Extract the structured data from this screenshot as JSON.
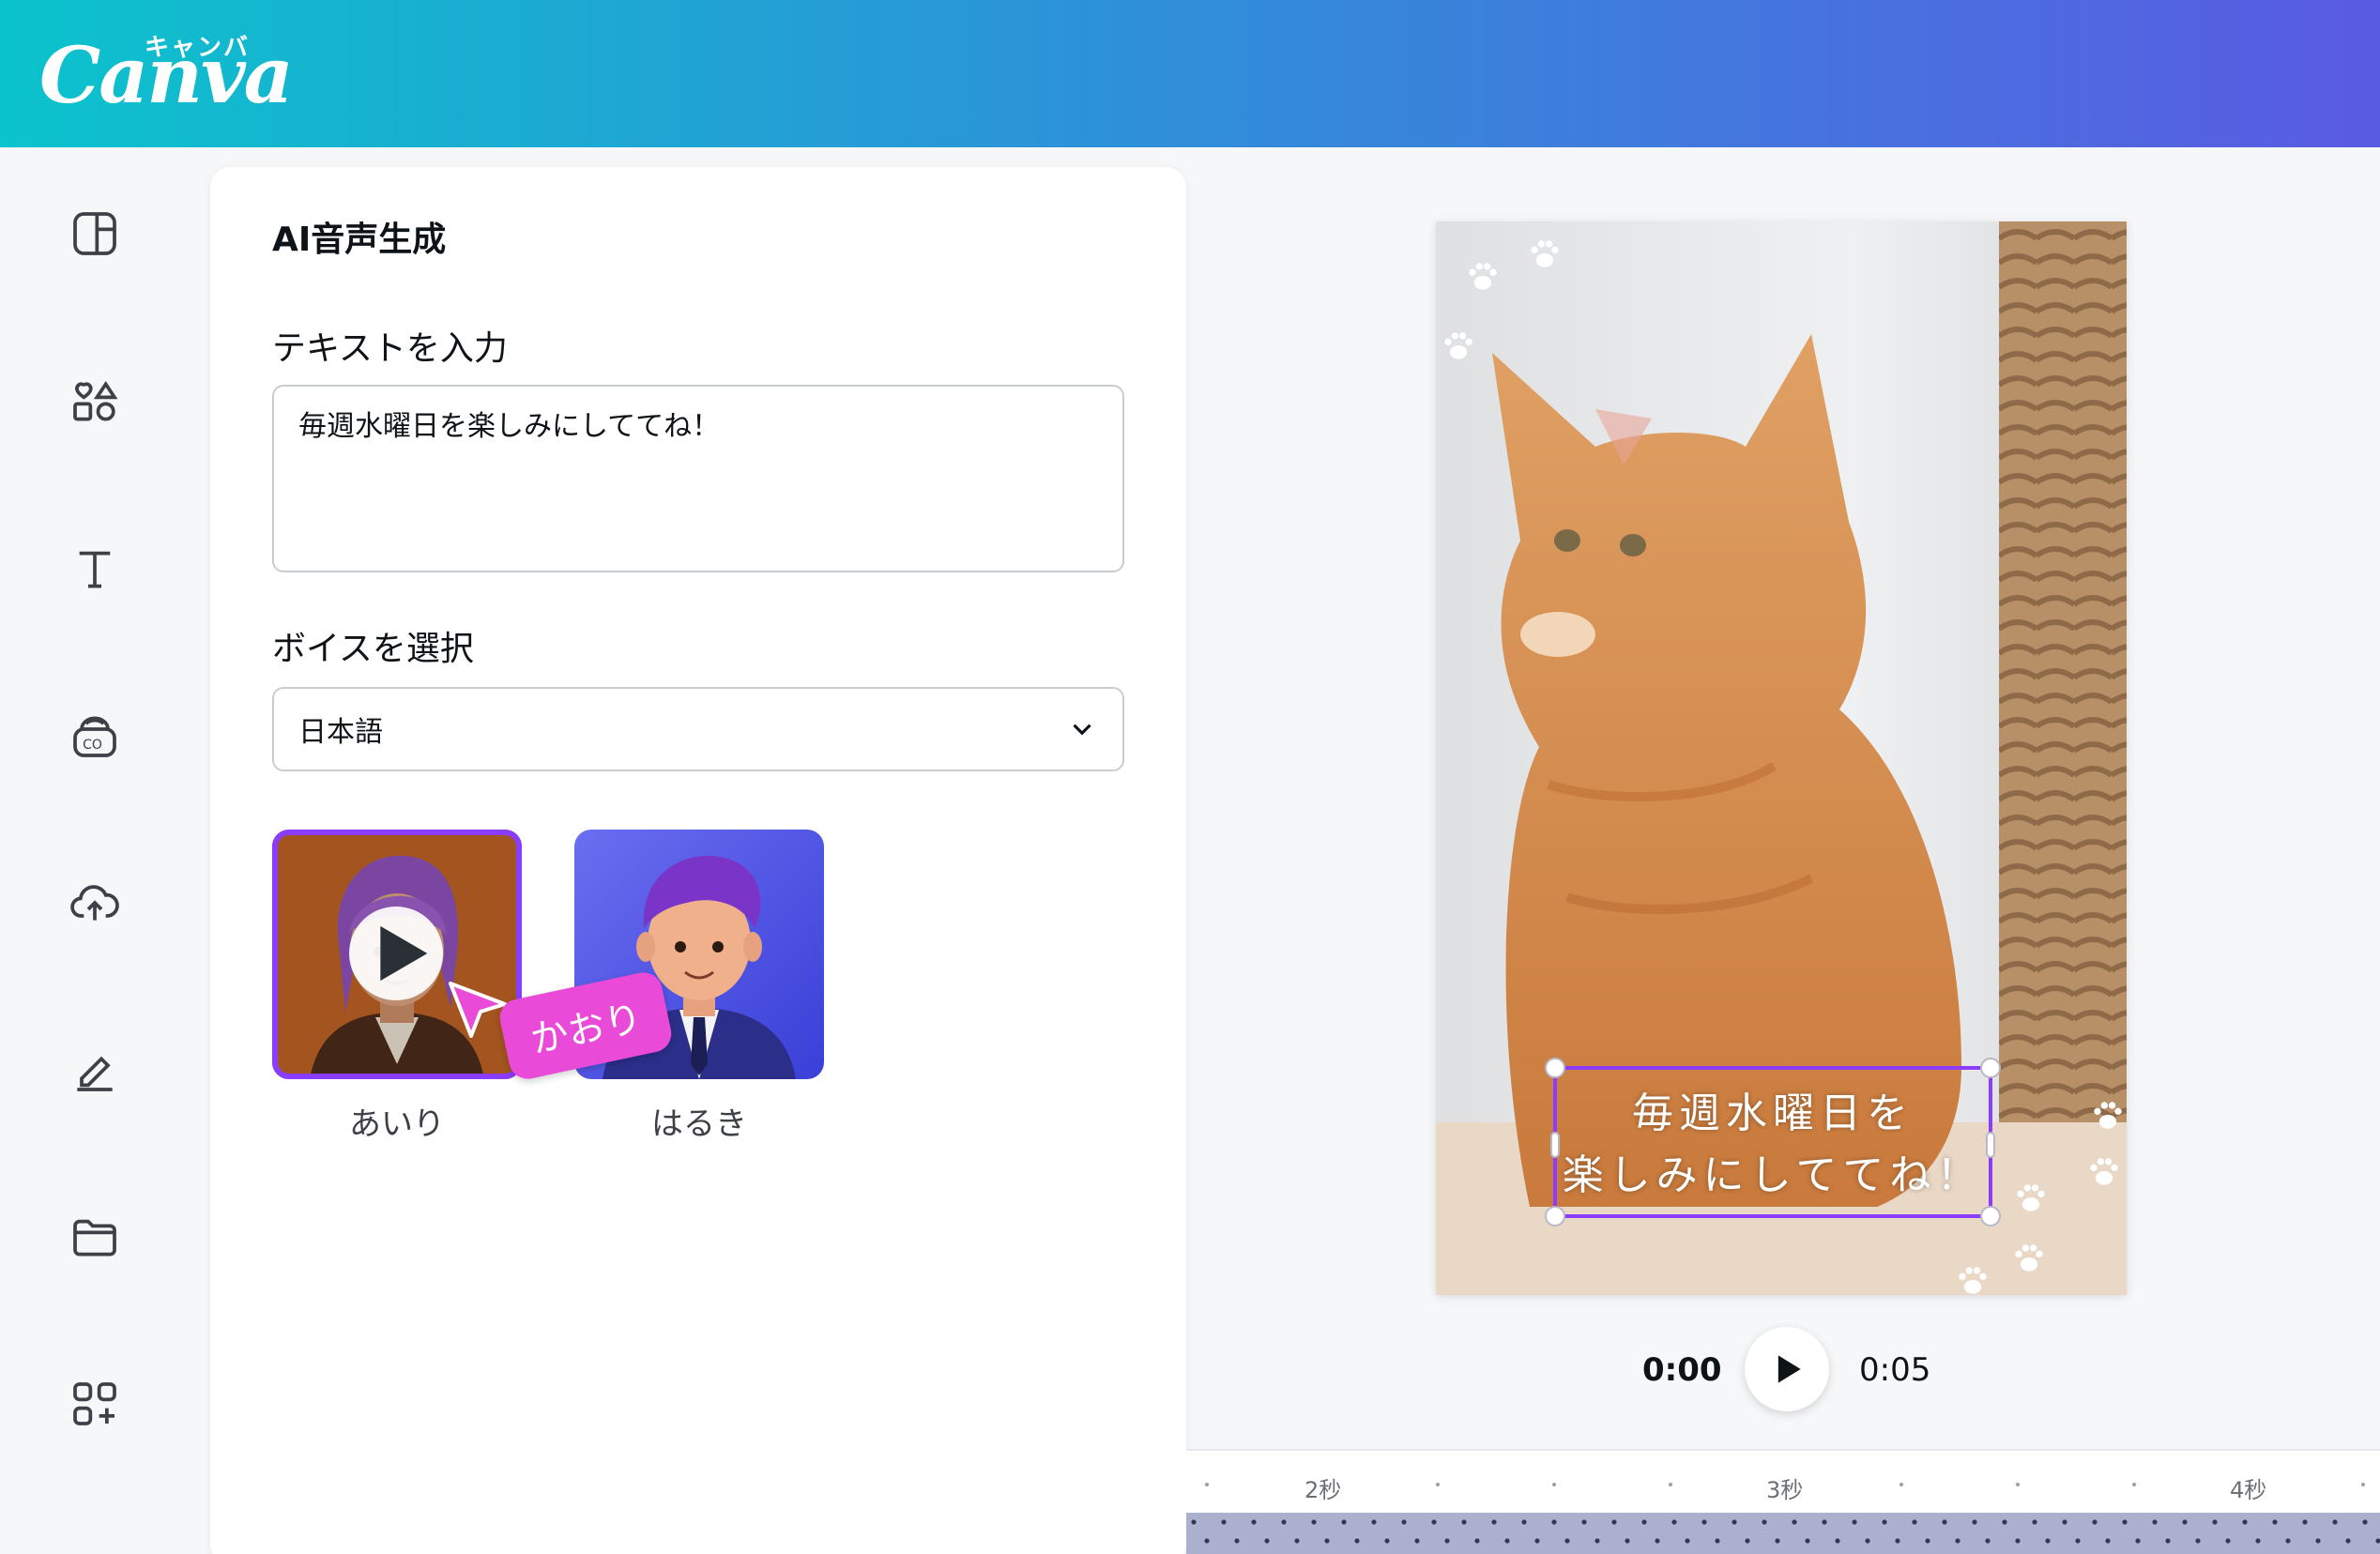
{
  "app": {
    "logo": "Canva",
    "logo_kana": "キャンバ"
  },
  "rail": [
    "layout-icon",
    "elements-icon",
    "text-icon",
    "brand-icon",
    "upload-icon",
    "draw-icon",
    "folder-icon",
    "apps-icon"
  ],
  "panel": {
    "title": "AI音声生成",
    "text_label": "テキストを入力",
    "text_value": "毎週水曜日を楽しみにしててね！",
    "voice_label": "ボイスを選択",
    "language": "日本語",
    "voices": [
      {
        "name": "あいり",
        "selected": true
      },
      {
        "name": "はるき",
        "selected": false
      }
    ],
    "hover_tooltip": "かおり"
  },
  "canvas": {
    "caption_line1": "毎週水曜日を",
    "caption_line2": "楽しみにしててね！"
  },
  "playback": {
    "current": "0:00",
    "total": "0:05"
  },
  "timeline": {
    "ticks": [
      "2秒",
      "3秒",
      "4秒"
    ]
  },
  "colors": {
    "accent": "#8b3dff",
    "tooltip": "#e94bd8"
  }
}
